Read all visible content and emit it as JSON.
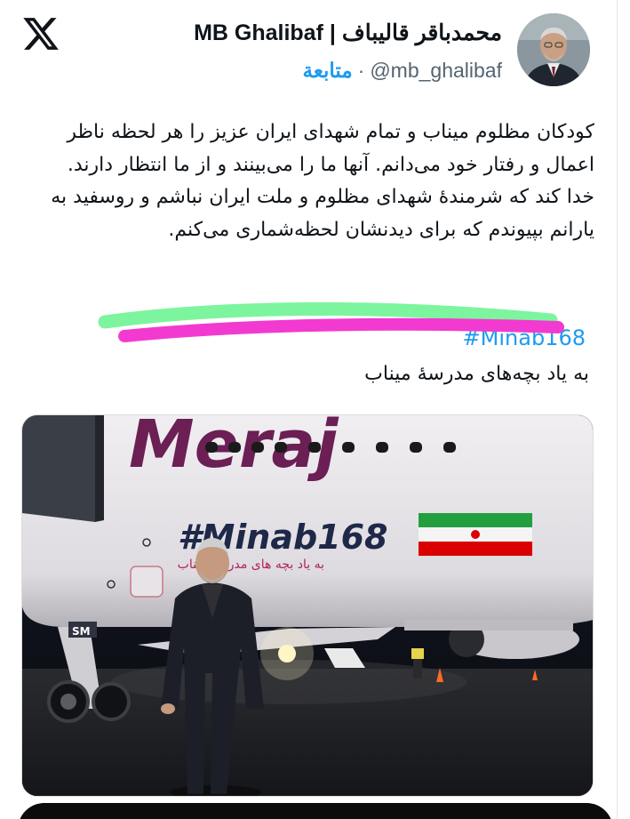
{
  "author": {
    "display_name": "MB Ghalibaf | محمدباقر قالیباف",
    "handle": "@mb_ghalibaf",
    "separator": "·",
    "follow_label": "متابعة"
  },
  "tweet": {
    "paragraph_1": "کودکان مظلوم میناب و تمام شهدای ایران عزیز را هر لحظه ناظر اعمال و رفتار خود می‌دانم. آنها ما را می‌بینند و از ما انتظار دارند.",
    "paragraph_2": "خدا کند که شرمندهٔ شهدای مظلوم و ملت ایران نباشم و روسفید به یارانم بپیوندم که برای دیدنشان لحظه‌شماری می‌کنم.",
    "hashtag": "#Minab168",
    "caption": "به یاد بچه‌های مدرسهٔ میناب"
  },
  "media": {
    "aircraft_brand": "Meraj",
    "fuselage_hashtag": "#Minab168",
    "fuselage_subtitle": "به یاد بچه های مدرسه میناب",
    "gear_marking": "SM",
    "colors": {
      "fuselage": "#e8e6ea",
      "brand_purple": "#6b1f55",
      "hashtag_navy": "#1e2848",
      "hashtag_number": "#b0245a",
      "flag_green": "#239f40",
      "flag_red": "#da0000"
    }
  },
  "markup": {
    "green_stroke": "#7cf59e",
    "magenta_stroke": "#f23ad0"
  },
  "icons": {
    "platform_logo": "x-logo-icon"
  }
}
